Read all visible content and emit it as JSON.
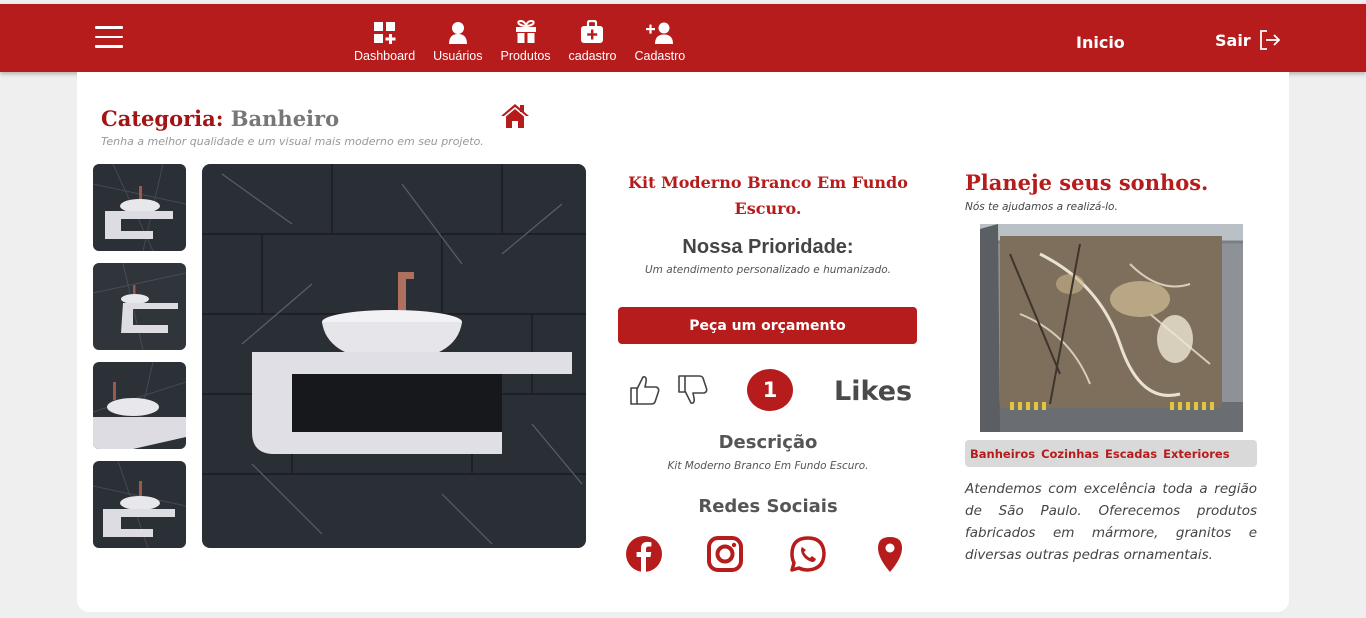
{
  "nav": {
    "items": [
      {
        "label": "Dashboard",
        "icon": "dashboard-add-icon"
      },
      {
        "label": "Usuários",
        "icon": "user-icon"
      },
      {
        "label": "Produtos",
        "icon": "gift-icon"
      },
      {
        "label": "cadastro",
        "icon": "medical-bag-icon"
      },
      {
        "label": "Cadastro",
        "icon": "user-plus-icon"
      }
    ],
    "inicio": "Inicio",
    "sair": "Sair"
  },
  "category": {
    "label": "Categoria:",
    "value": "Banheiro",
    "subtitle": "Tenha a melhor qualidade e um visual mais moderno em seu projeto."
  },
  "product": {
    "title": "Kit Moderno Branco Em Fundo Escuro.",
    "priority_heading": "Nossa Prioridade:",
    "priority_text": "Um atendimento personalizado e humanizado.",
    "quote_button": "Peça um orçamento",
    "likes_count": "1",
    "likes_label": "Likes",
    "description_heading": "Descrição",
    "description_text": "Kit Moderno Branco Em Fundo Escuro.",
    "social_heading": "Redes Sociais",
    "social_icons": [
      "facebook-icon",
      "instagram-icon",
      "whatsapp-icon",
      "location-pin-icon"
    ]
  },
  "aside": {
    "title": "Planeje seus sonhos.",
    "subtitle": "Nós te ajudamos a realizá-lo.",
    "categories": [
      "Banheiros",
      "Cozinhas",
      "Escadas",
      "Exteriores"
    ],
    "about": "Atendemos com excelência toda a região de São Paulo. Oferecemos produtos fabricados em mármore, granitos e diversas outras pedras ornamentais."
  },
  "colors": {
    "brand": "#b71c1c",
    "background": "#efefef",
    "card": "#ffffff"
  }
}
